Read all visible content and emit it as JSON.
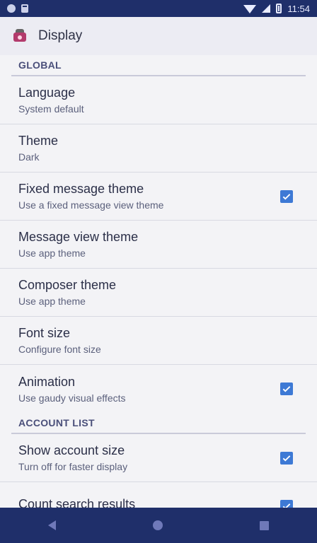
{
  "status_bar": {
    "time": "11:54"
  },
  "app_bar": {
    "title": "Display",
    "icon": "app-logo-icon"
  },
  "sections": [
    {
      "header": "GLOBAL",
      "rows": [
        {
          "title": "Language",
          "subtitle": "System default",
          "checkbox": null
        },
        {
          "title": "Theme",
          "subtitle": "Dark",
          "checkbox": null
        },
        {
          "title": "Fixed message theme",
          "subtitle": "Use a fixed message view theme",
          "checkbox": true
        },
        {
          "title": "Message view theme",
          "subtitle": "Use app theme",
          "checkbox": null
        },
        {
          "title": "Composer theme",
          "subtitle": "Use app theme",
          "checkbox": null
        },
        {
          "title": "Font size",
          "subtitle": "Configure font size",
          "checkbox": null
        },
        {
          "title": "Animation",
          "subtitle": "Use gaudy visual effects",
          "checkbox": true
        }
      ]
    },
    {
      "header": "ACCOUNT LIST",
      "rows": [
        {
          "title": "Show account size",
          "subtitle": "Turn off for faster display",
          "checkbox": true
        },
        {
          "title": "Count search results",
          "subtitle": "",
          "checkbox": true
        }
      ]
    }
  ],
  "nav_bar": {
    "back": "back-icon",
    "home": "home-icon",
    "recent": "recent-apps-icon"
  },
  "colors": {
    "status_bar": "#1f2f6a",
    "checkbox": "#3d79d5",
    "background": "#f3f3f6"
  }
}
